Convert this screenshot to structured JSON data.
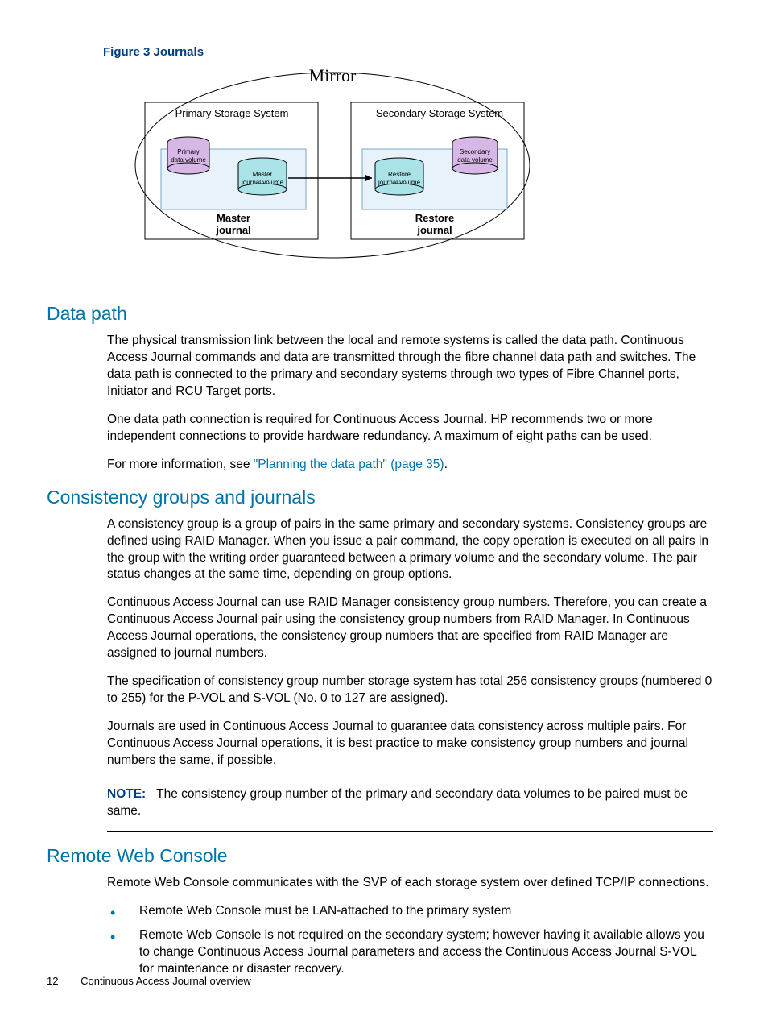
{
  "figure": {
    "label": "Figure 3 Journals",
    "mirror": "Mirror",
    "primary_system": "Primary Storage System",
    "secondary_system": "Secondary Storage System",
    "primary_vol": "Primary data volume",
    "secondary_vol": "Secondary data volume",
    "master_jvol": "Master journal volume",
    "restore_jvol": "Restore journal volume",
    "master_journal": "Master journal",
    "restore_journal": "Restore journal"
  },
  "sections": {
    "datapath": {
      "title": "Data path",
      "p1": "The physical transmission link between the local and remote systems is called the data path. Continuous Access Journal commands and data are transmitted through the fibre channel data path and switches. The data path is connected to the primary and secondary systems through two types of Fibre Channel ports, Initiator and RCU Target ports.",
      "p2": "One data path connection is required for Continuous Access Journal. HP recommends two or more independent connections to provide hardware redundancy. A maximum of eight paths can be used.",
      "p3_prefix": "For more information, see ",
      "p3_link": "\"Planning the data path\" (page 35)",
      "p3_suffix": "."
    },
    "cgj": {
      "title": "Consistency groups and journals",
      "p1": "A consistency group is a group of pairs in the same primary and secondary systems. Consistency groups are defined using RAID Manager. When you issue a pair command, the copy operation is executed on all pairs in the group with the writing order guaranteed between a primary volume and the secondary volume. The pair status changes at the same time, depending on group options.",
      "p2": "Continuous Access Journal can use RAID Manager consistency group numbers. Therefore, you can create a Continuous Access Journal pair using the consistency group numbers from RAID Manager. In Continuous Access Journal operations, the consistency group numbers that are specified from RAID Manager are assigned to journal numbers.",
      "p3": "The specification of consistency group number storage system has total 256 consistency groups (numbered 0 to 255) for the P-VOL and S-VOL (No. 0 to 127 are assigned).",
      "p4": "Journals are used in Continuous Access Journal to guarantee data consistency across multiple pairs. For Continuous Access Journal operations, it is best practice to make consistency group numbers and journal numbers the same, if possible.",
      "note_label": "NOTE:",
      "note_text": "The consistency group number of the primary and secondary data volumes to be paired must be same."
    },
    "rwc": {
      "title": "Remote Web Console",
      "p1": "Remote Web Console communicates with the SVP of each storage system over defined TCP/IP connections.",
      "b1": "Remote Web Console must be LAN-attached to the primary system",
      "b2": "Remote Web Console is not required on the secondary system; however having it available allows you to change Continuous Access Journal parameters and access the Continuous Access Journal S-VOL for maintenance or disaster recovery."
    }
  },
  "footer": {
    "page": "12",
    "chapter": "Continuous Access Journal overview"
  }
}
